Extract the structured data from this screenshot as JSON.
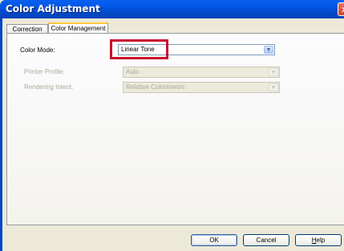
{
  "window": {
    "title": "Color Adjustment",
    "close_glyph": "✕"
  },
  "tabs": [
    {
      "label": "Correction",
      "selected": false
    },
    {
      "label": "Color Management",
      "selected": true
    }
  ],
  "fields": {
    "color_mode": {
      "label": "Color Mode:",
      "value": "Linear Tone",
      "enabled": true
    },
    "printer_profile": {
      "label": "Printer Profile:",
      "value": "Auto",
      "enabled": false
    },
    "rendering_intent": {
      "label": "Rendering Intent:",
      "value": "Relative Colorimetric",
      "enabled": false
    }
  },
  "buttons": {
    "ok": "OK",
    "cancel": "Cancel",
    "help_prefix": "H",
    "help_rest": "elp"
  },
  "icons": {
    "dropdown_arrow": "chevron-down-icon",
    "close": "close-icon"
  },
  "colors": {
    "highlight": "#c8102e",
    "titlebar": "#0058e6"
  }
}
